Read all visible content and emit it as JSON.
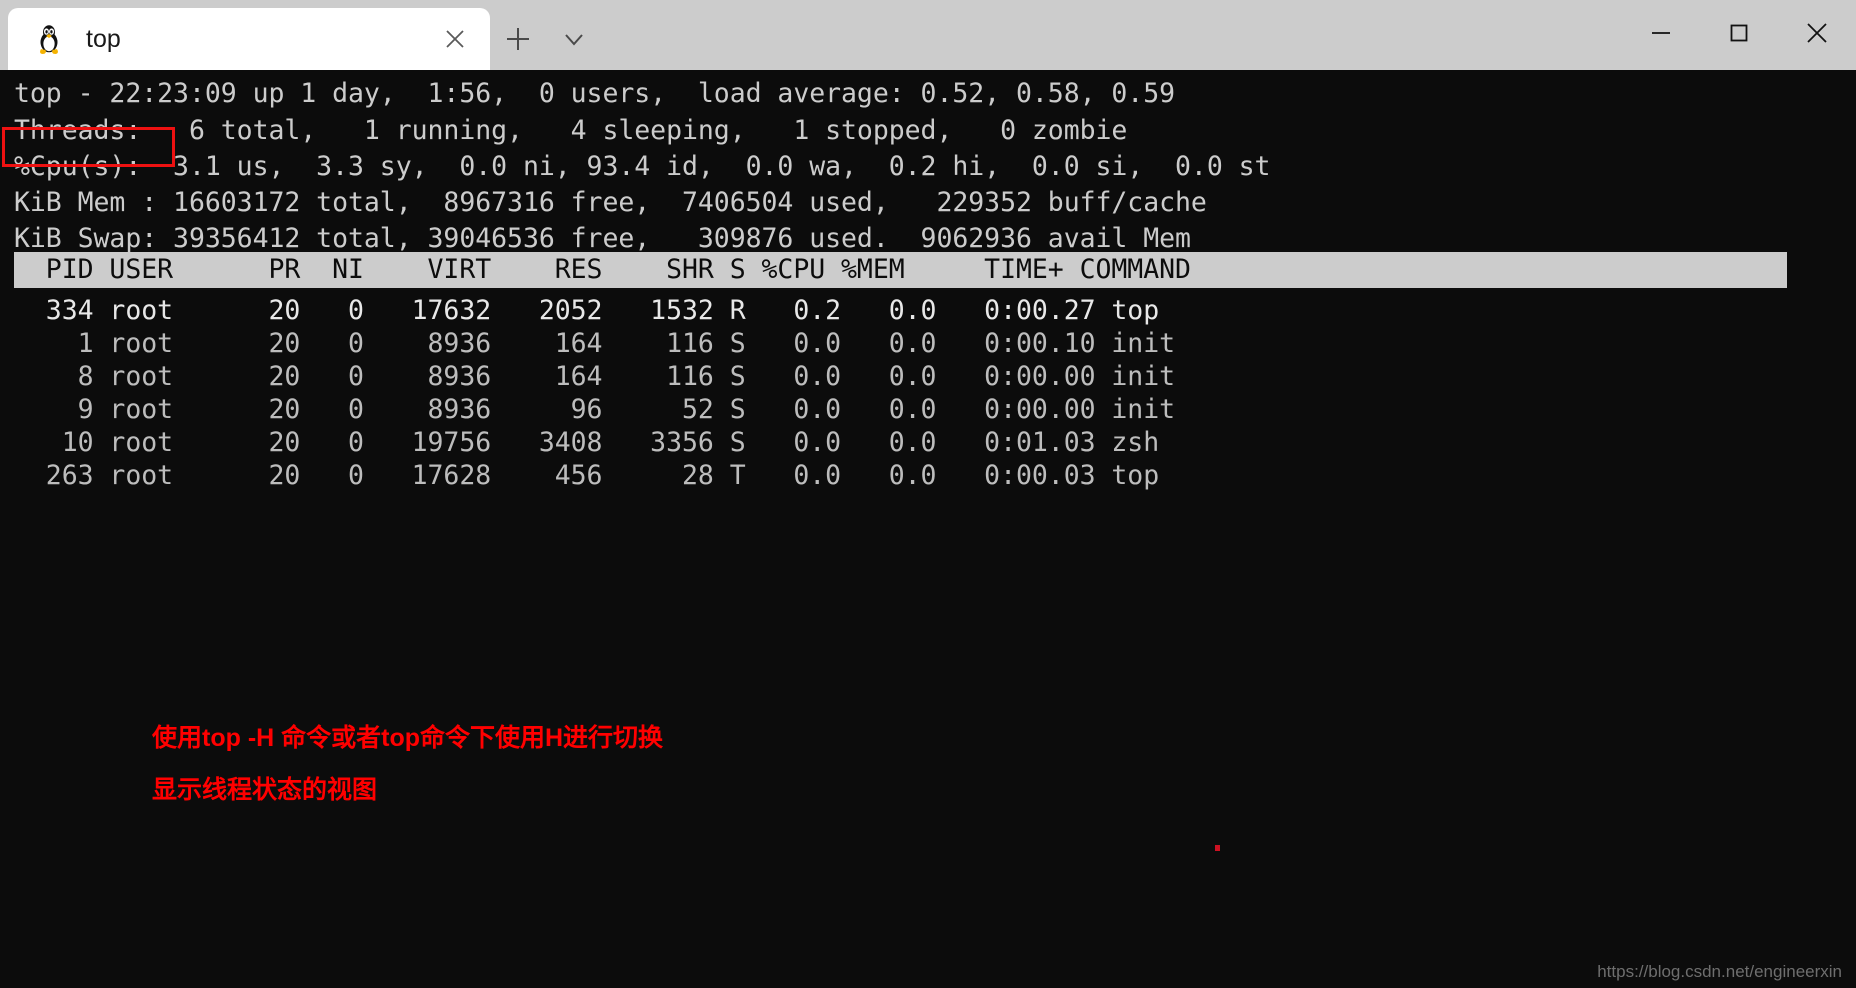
{
  "window": {
    "controls": {
      "minimize": "minimize",
      "maximize": "maximize",
      "close": "close"
    }
  },
  "tabbar": {
    "tabs": [
      {
        "title": "top",
        "icon": "linux-penguin-icon",
        "close_label": "×"
      }
    ],
    "new_tab_label": "+",
    "dropdown_label": "⌄"
  },
  "terminal": {
    "summary_lines": [
      "top - 22:23:09 up 1 day,  1:56,  0 users,  load average: 0.52, 0.58, 0.59",
      "Threads:   6 total,   1 running,   4 sleeping,   1 stopped,   0 zombie",
      "%Cpu(s):  3.1 us,  3.3 sy,  0.0 ni, 93.4 id,  0.0 wa,  0.2 hi,  0.0 si,  0.0 st",
      "KiB Mem : 16603172 total,  8967316 free,  7406504 used,   229352 buff/cache",
      "KiB Swap: 39356412 total, 39046536 free,   309876 used.  9062936 avail Mem"
    ],
    "summary": {
      "uptime_line": {
        "program": "top",
        "time": "22:23:09",
        "up": "1 day,  1:56",
        "users": "0",
        "load_average": [
          "0.52",
          "0.58",
          "0.59"
        ]
      },
      "threads_line": {
        "label": "Threads:",
        "total": "6",
        "running": "1",
        "sleeping": "4",
        "stopped": "1",
        "zombie": "0"
      },
      "cpu_line": {
        "label": "%Cpu(s):",
        "us": "3.1",
        "sy": "3.3",
        "ni": "0.0",
        "id": "93.4",
        "wa": "0.0",
        "hi": "0.2",
        "si": "0.0",
        "st": "0.0"
      },
      "mem_line": {
        "label": "KiB Mem :",
        "total": "16603172",
        "free": "8967316",
        "used": "7406504",
        "buff_cache": "229352"
      },
      "swap_line": {
        "label": "KiB Swap:",
        "total": "39356412",
        "free": "39046536",
        "used": "309876",
        "avail_mem": "9062936"
      }
    },
    "table": {
      "header_text": "  PID USER      PR  NI    VIRT    RES    SHR S %CPU %MEM     TIME+ COMMAND                                     ",
      "columns": [
        "PID",
        "USER",
        "PR",
        "NI",
        "VIRT",
        "RES",
        "SHR",
        "S",
        "%CPU",
        "%MEM",
        "TIME+",
        "COMMAND"
      ],
      "rows": [
        {
          "text": "  334 root      20   0   17632   2052   1532 R   0.2   0.0   0:00.27 top",
          "pid": "334",
          "user": "root",
          "pr": "20",
          "ni": "0",
          "virt": "17632",
          "res": "2052",
          "shr": "1532",
          "s": "R",
          "cpu": "0.2",
          "mem": "0.0",
          "time": "0:00.27",
          "command": "top",
          "highlighted": true
        },
        {
          "text": "    1 root      20   0    8936    164    116 S   0.0   0.0   0:00.10 init",
          "pid": "1",
          "user": "root",
          "pr": "20",
          "ni": "0",
          "virt": "8936",
          "res": "164",
          "shr": "116",
          "s": "S",
          "cpu": "0.0",
          "mem": "0.0",
          "time": "0:00.10",
          "command": "init",
          "highlighted": false
        },
        {
          "text": "    8 root      20   0    8936    164    116 S   0.0   0.0   0:00.00 init",
          "pid": "8",
          "user": "root",
          "pr": "20",
          "ni": "0",
          "virt": "8936",
          "res": "164",
          "shr": "116",
          "s": "S",
          "cpu": "0.0",
          "mem": "0.0",
          "time": "0:00.00",
          "command": "init",
          "highlighted": false
        },
        {
          "text": "    9 root      20   0    8936     96     52 S   0.0   0.0   0:00.00 init",
          "pid": "9",
          "user": "root",
          "pr": "20",
          "ni": "0",
          "virt": "8936",
          "res": "96",
          "shr": "52",
          "s": "S",
          "cpu": "0.0",
          "mem": "0.0",
          "time": "0:00.00",
          "command": "init",
          "highlighted": false
        },
        {
          "text": "   10 root      20   0   19756   3408   3356 S   0.0   0.0   0:01.03 zsh",
          "pid": "10",
          "user": "root",
          "pr": "20",
          "ni": "0",
          "virt": "19756",
          "res": "3408",
          "shr": "3356",
          "s": "S",
          "cpu": "0.0",
          "mem": "0.0",
          "time": "0:01.03",
          "command": "zsh",
          "highlighted": false
        },
        {
          "text": "  263 root      20   0   17628    456     28 T   0.0   0.0   0:00.03 top",
          "pid": "263",
          "user": "root",
          "pr": "20",
          "ni": "0",
          "virt": "17628",
          "res": "456",
          "shr": "28",
          "s": "T",
          "cpu": "0.0",
          "mem": "0.0",
          "time": "0:00.03",
          "command": "top",
          "highlighted": false
        }
      ]
    }
  },
  "annotations": {
    "highlight_color": "#ee1111",
    "text_color": "#ff0000",
    "line1": "使用top -H 命令或者top命令下使用H进行切换",
    "line2": "显示线程状态的视图"
  },
  "watermark": "https://blog.csdn.net/engineerxin"
}
